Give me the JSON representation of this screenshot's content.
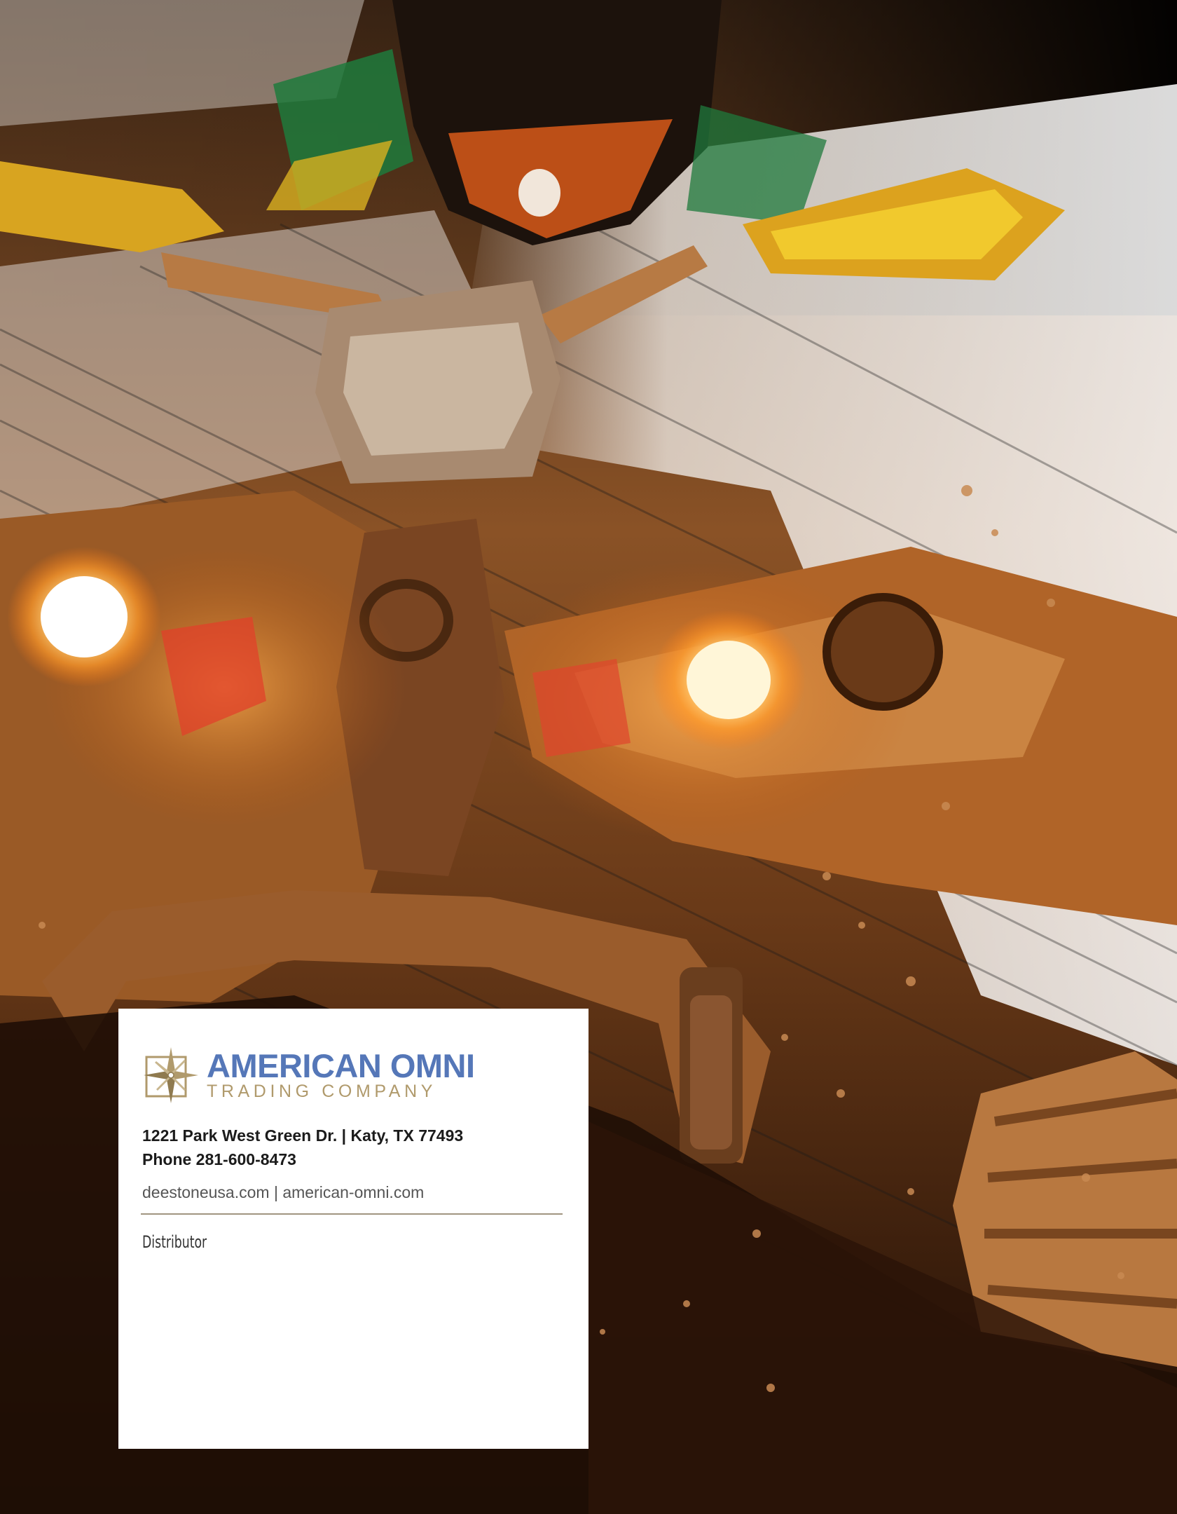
{
  "company": {
    "name_line1": "AMERICAN OMNI",
    "name_line2": "TRADING COMPANY",
    "logo_icon": "compass-star-icon",
    "colors": {
      "brand_blue": "#5577b8",
      "brand_gold": "#b09a6c"
    }
  },
  "contact": {
    "address": "1221 Park West Green Dr. | Katy, TX 77493",
    "phone": "Phone 281-600-8473",
    "websites": "deestoneusa.com | american-omni.com"
  },
  "distributor_label": "Distributor"
}
